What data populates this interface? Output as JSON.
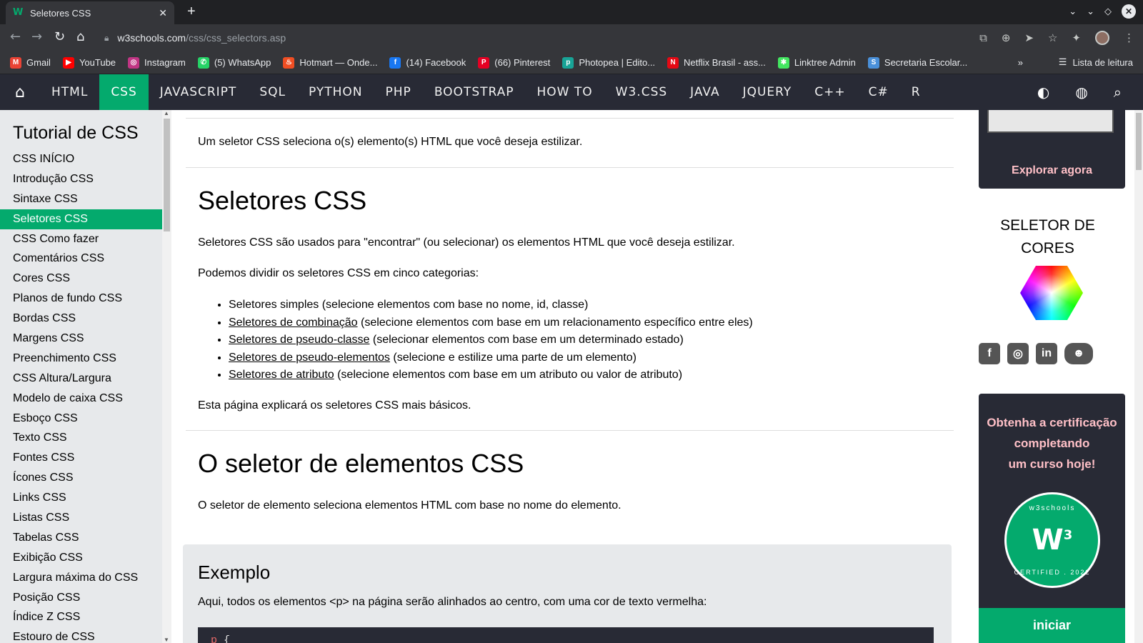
{
  "browser": {
    "tab_title": "Seletores CSS",
    "url_host": "w3schools.com",
    "url_path": "/css/css_selectors.asp",
    "bookmarks": [
      {
        "label": "Gmail",
        "icon": "gmail-icon",
        "color": "#ea4335",
        "glyph": "M"
      },
      {
        "label": "YouTube",
        "icon": "youtube-icon",
        "color": "#ff0000",
        "glyph": "▶"
      },
      {
        "label": "Instagram",
        "icon": "instagram-icon",
        "color": "#c13584",
        "glyph": "◎"
      },
      {
        "label": "(5) WhatsApp",
        "icon": "whatsapp-icon",
        "color": "#25d366",
        "glyph": "✆"
      },
      {
        "label": "Hotmart — Onde...",
        "icon": "hotmart-icon",
        "color": "#f04e23",
        "glyph": "♨"
      },
      {
        "label": "(14) Facebook",
        "icon": "facebook-icon",
        "color": "#1877f2",
        "glyph": "f"
      },
      {
        "label": "(66) Pinterest",
        "icon": "pinterest-icon",
        "color": "#e60023",
        "glyph": "P"
      },
      {
        "label": "Photopea | Edito...",
        "icon": "photopea-icon",
        "color": "#18a497",
        "glyph": "p"
      },
      {
        "label": "Netflix Brasil - ass...",
        "icon": "netflix-icon",
        "color": "#e50914",
        "glyph": "N"
      },
      {
        "label": "Linktree Admin",
        "icon": "linktree-icon",
        "color": "#43e660",
        "glyph": "✱"
      },
      {
        "label": "Secretaria Escolar...",
        "icon": "secretaria-icon",
        "color": "#4a90d9",
        "glyph": "S"
      }
    ],
    "bookmarks_more": "»",
    "reading_list": "Lista de leitura"
  },
  "topnav": {
    "items": [
      "HTML",
      "CSS",
      "JAVASCRIPT",
      "SQL",
      "PYTHON",
      "PHP",
      "BOOTSTRAP",
      "HOW TO",
      "W3.CSS",
      "JAVA",
      "JQUERY",
      "C++",
      "C#",
      "R"
    ],
    "active": "CSS",
    "accent": "#04aa6d",
    "bg": "#282a35"
  },
  "sidebar": {
    "title": "Tutorial de CSS",
    "links": [
      "CSS INÍCIO",
      "Introdução CSS",
      "Sintaxe CSS",
      "Seletores CSS",
      "CSS Como fazer",
      "Comentários CSS",
      "Cores CSS",
      "Planos de fundo CSS",
      "Bordas CSS",
      "Margens CSS",
      "Preenchimento CSS",
      "CSS Altura/Largura",
      "Modelo de caixa CSS",
      "Esboço CSS",
      "Texto CSS",
      "Fontes CSS",
      "Ícones CSS",
      "Links CSS",
      "Listas CSS",
      "Tabelas CSS",
      "Exibição CSS",
      "Largura máxima do CSS",
      "Posição CSS",
      "Índice Z CSS",
      "Estouro de CSS"
    ],
    "active_index": 3
  },
  "main": {
    "intro": "Um seletor CSS seleciona o(s) elemento(s) HTML que você deseja estilizar.",
    "h1_selectors": "Seletores CSS",
    "p_used": "Seletores CSS são usados para \"encontrar\" (ou selecionar) os elementos HTML que você deseja estilizar.",
    "p_divide": "Podemos dividir os seletores CSS em cinco categorias:",
    "categories": [
      {
        "link": "",
        "text": "Seletores simples (selecione elementos com base no nome, id, classe)"
      },
      {
        "link": "Seletores de combinação",
        "text": " (selecione elementos com base em um relacionamento específico entre eles)"
      },
      {
        "link": "Seletores de pseudo-classe",
        "text": " (selecionar elementos com base em um determinado estado)"
      },
      {
        "link": "Seletores de pseudo-elementos",
        "text": " (selecione e estilize uma parte de um elemento)"
      },
      {
        "link": "Seletores de atributo",
        "text": " (selecione elementos com base em um atributo ou valor de atributo)"
      }
    ],
    "p_explain": "Esta página explicará os seletores CSS mais básicos.",
    "h1_element": "O seletor de elementos CSS",
    "p_element": "O seletor de elemento seleciona elementos HTML com base no nome do elemento.",
    "example": {
      "title": "Exemplo",
      "desc": "Aqui, todos os elementos <p> na página serão alinhados ao centro, com uma cor de texto vermelha:",
      "code_selector": "p",
      "code_rest": " {"
    }
  },
  "right": {
    "explore": "Explorar agora",
    "picker_title_1": "SELETOR DE",
    "picker_title_2": "CORES",
    "social": [
      {
        "icon": "facebook-icon",
        "glyph": "f"
      },
      {
        "icon": "instagram-icon",
        "glyph": "◎"
      },
      {
        "icon": "linkedin-icon",
        "glyph": "in"
      },
      {
        "icon": "discord-icon",
        "glyph": "☻"
      }
    ],
    "cert_line1": "Obtenha a certificação",
    "cert_line2": "completando",
    "cert_line3": "um curso hoje!",
    "badge_top": "w3schools",
    "badge_bottom": "CERTIFIED . 2022",
    "badge_logo": "W",
    "badge_sup": "3",
    "cert_button": "iniciar"
  }
}
